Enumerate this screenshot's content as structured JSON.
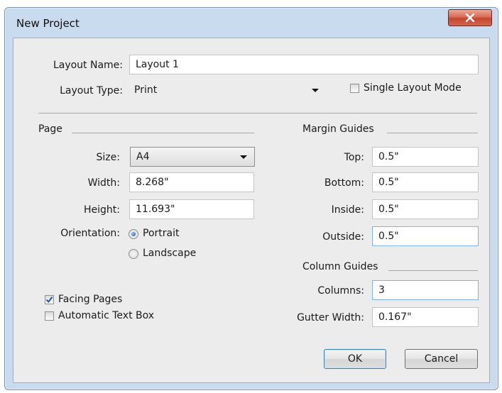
{
  "window": {
    "title": "New Project"
  },
  "layout_name": {
    "label": "Layout Name:",
    "value": "Layout 1"
  },
  "layout_type": {
    "label": "Layout Type:",
    "value": "Print"
  },
  "single_layout_mode": {
    "label": "Single Layout Mode",
    "checked": false
  },
  "page": {
    "section_label": "Page",
    "size": {
      "label": "Size:",
      "value": "A4"
    },
    "width": {
      "label": "Width:",
      "value": "8.268\""
    },
    "height": {
      "label": "Height:",
      "value": "11.693\""
    },
    "orientation": {
      "label": "Orientation:",
      "options": [
        "Portrait",
        "Landscape"
      ],
      "selected": "Portrait"
    }
  },
  "facing_pages": {
    "label": "Facing Pages",
    "checked": true
  },
  "automatic_text_box": {
    "label": "Automatic Text Box",
    "checked": false
  },
  "margin_guides": {
    "section_label": "Margin Guides",
    "top": {
      "label": "Top:",
      "value": "0.5\""
    },
    "bottom": {
      "label": "Bottom:",
      "value": "0.5\""
    },
    "inside": {
      "label": "Inside:",
      "value": "0.5\""
    },
    "outside": {
      "label": "Outside:",
      "value": "0.5\""
    }
  },
  "column_guides": {
    "section_label": "Column Guides",
    "columns": {
      "label": "Columns:",
      "value": "3"
    },
    "gutter_width": {
      "label": "Gutter Width:",
      "value": "0.167\""
    }
  },
  "buttons": {
    "ok": "OK",
    "cancel": "Cancel"
  },
  "colors": {
    "title_bar": "#c9dbee",
    "client_bg": "#ececec",
    "close_button": "#c5452e",
    "focus_border": "#7eb4ea",
    "check_blue": "#1d5a9c"
  }
}
